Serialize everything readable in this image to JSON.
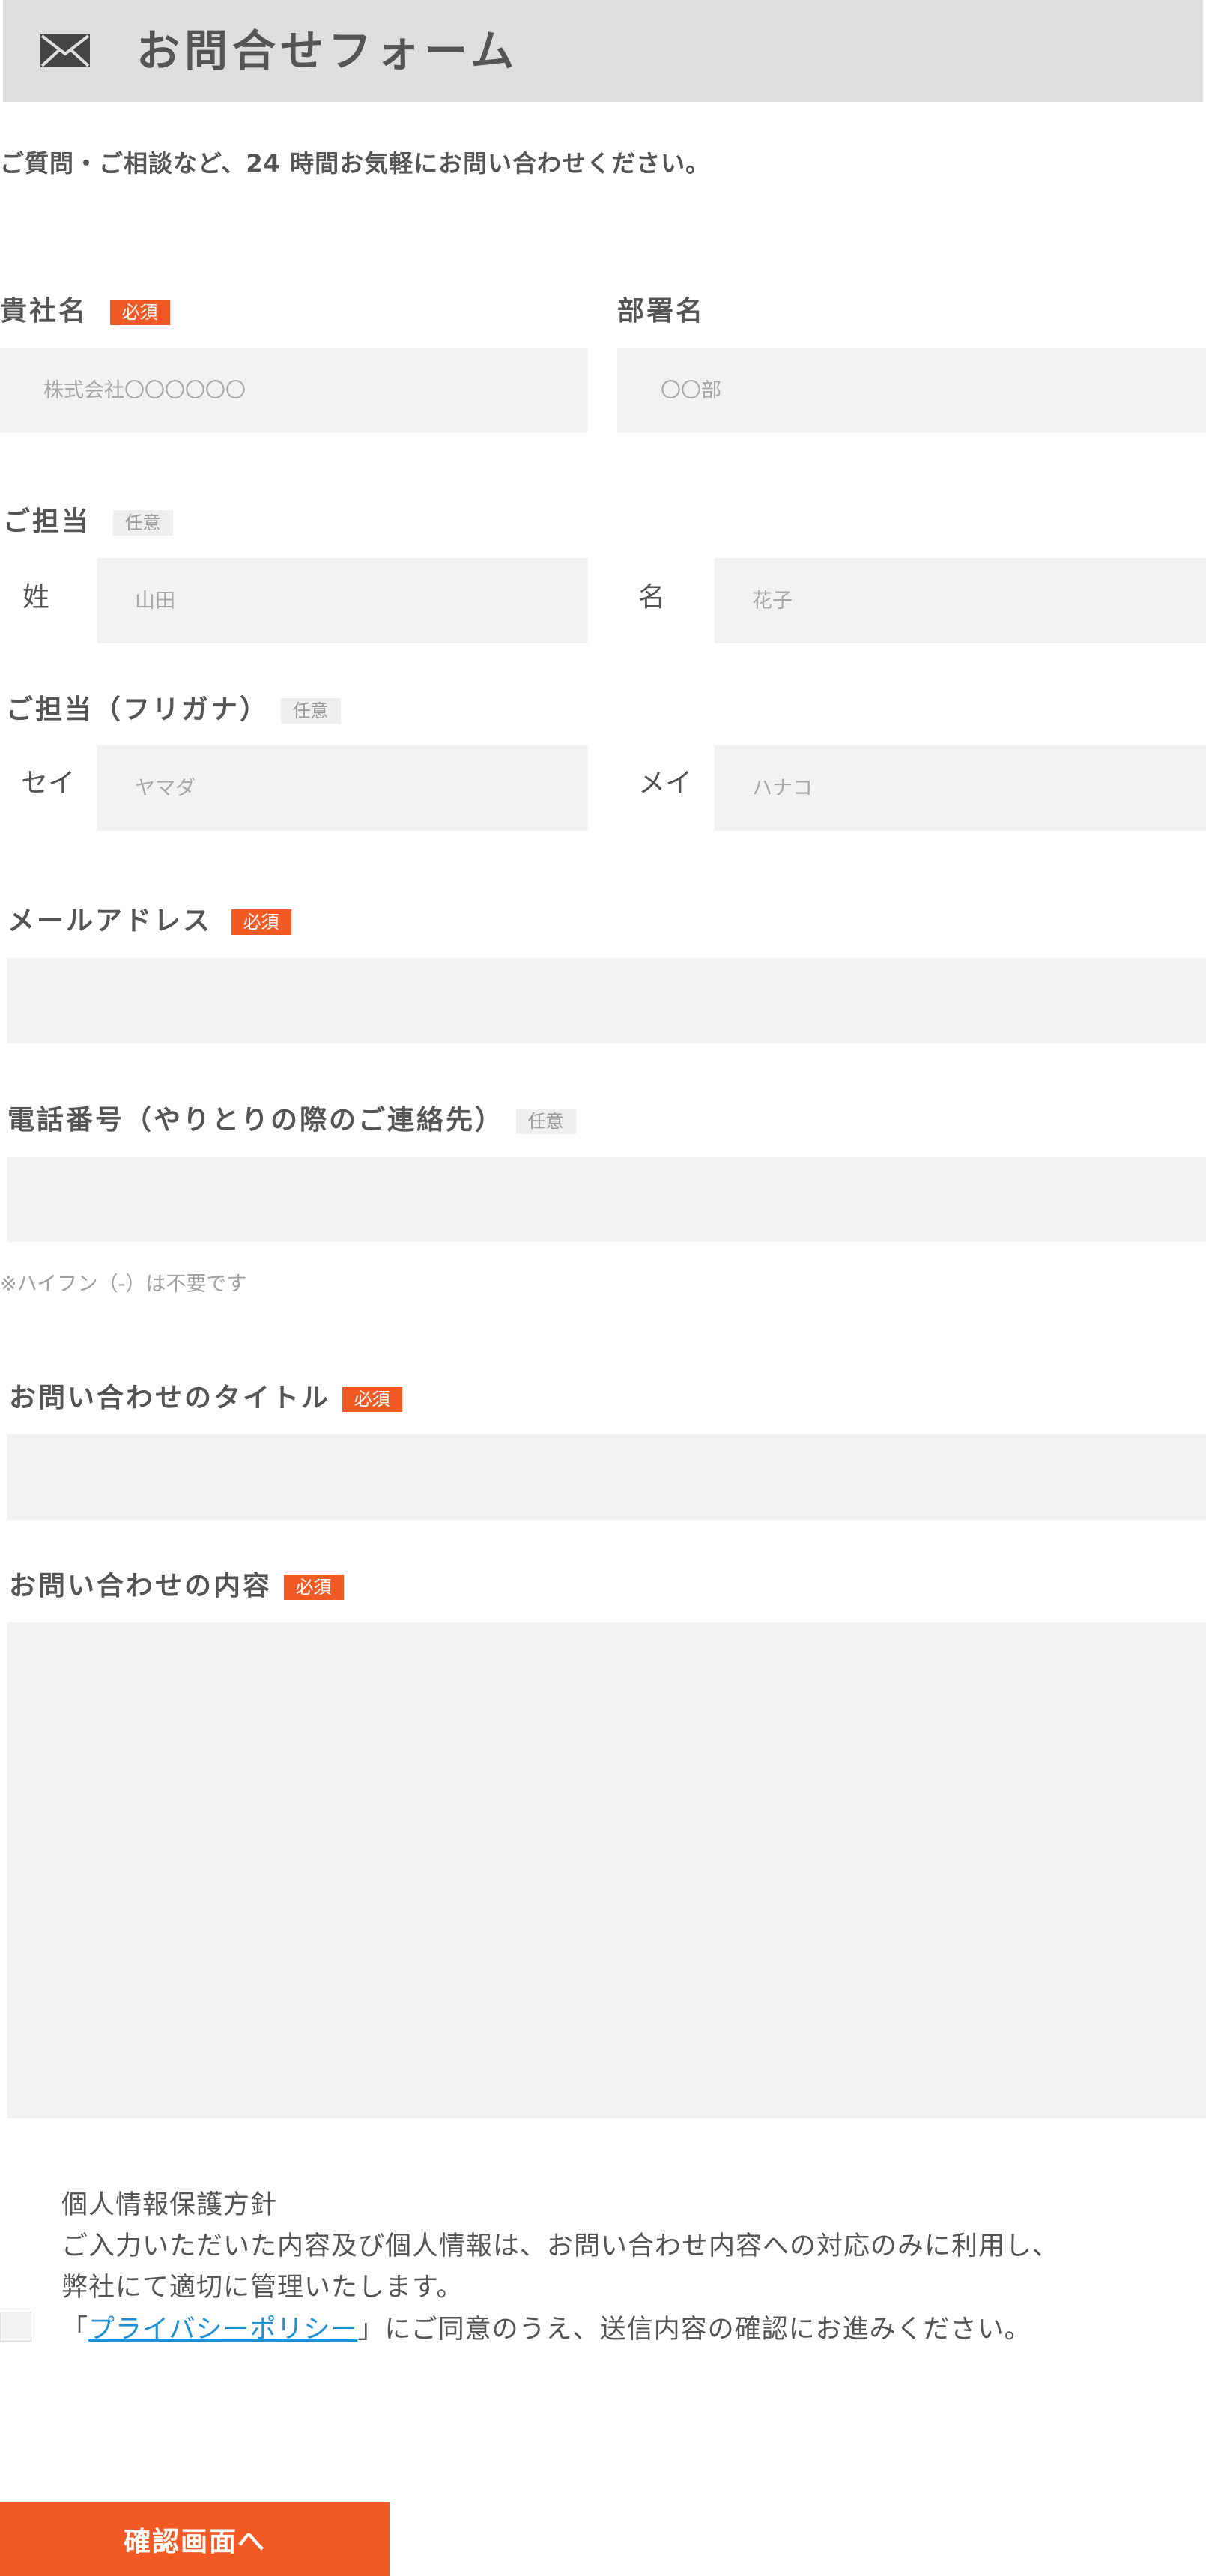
{
  "header": {
    "icon": "envelope-icon",
    "title": "お問合せフォーム"
  },
  "intro": "ご質問・ご相談など、24 時間お気軽にお問い合わせください。",
  "badges": {
    "required": "必須",
    "optional": "任意"
  },
  "company": {
    "label": "貴社名",
    "placeholder": "株式会社〇〇〇〇〇〇"
  },
  "department": {
    "label": "部署名",
    "placeholder": "〇〇部"
  },
  "person": {
    "label": "ご担当",
    "last_label": "姓",
    "last_placeholder": "山田",
    "first_label": "名",
    "first_placeholder": "花子"
  },
  "kana": {
    "label": "ご担当（フリガナ）",
    "last_label": "セイ",
    "last_placeholder": "ヤマダ",
    "first_label": "メイ",
    "first_placeholder": "ハナコ"
  },
  "email": {
    "label": "メールアドレス",
    "value": ""
  },
  "phone": {
    "label": "電話番号（やりとりの際のご連絡先）",
    "value": "",
    "note": "※ハイフン（-）は不要です"
  },
  "subject": {
    "label": "お問い合わせのタイトル",
    "value": ""
  },
  "message": {
    "label": "お問い合わせの内容",
    "value": ""
  },
  "privacy": {
    "title": "個人情報保護方針",
    "line1": "ご入力いただいた内容及び個人情報は、お問い合わせ内容への対応のみに利用し、",
    "line2": "弊社にて適切に管理いたします。",
    "pre": "「",
    "link": "プライバシーポリシー",
    "post": "」にご同意のうえ、送信内容の確認にお進みください。",
    "checked": false
  },
  "submit_label": "確認画面へ",
  "colors": {
    "accent": "#f15a24",
    "header_bg": "#dedede",
    "field_bg": "#f2f2f2",
    "link": "#1e90d6"
  }
}
